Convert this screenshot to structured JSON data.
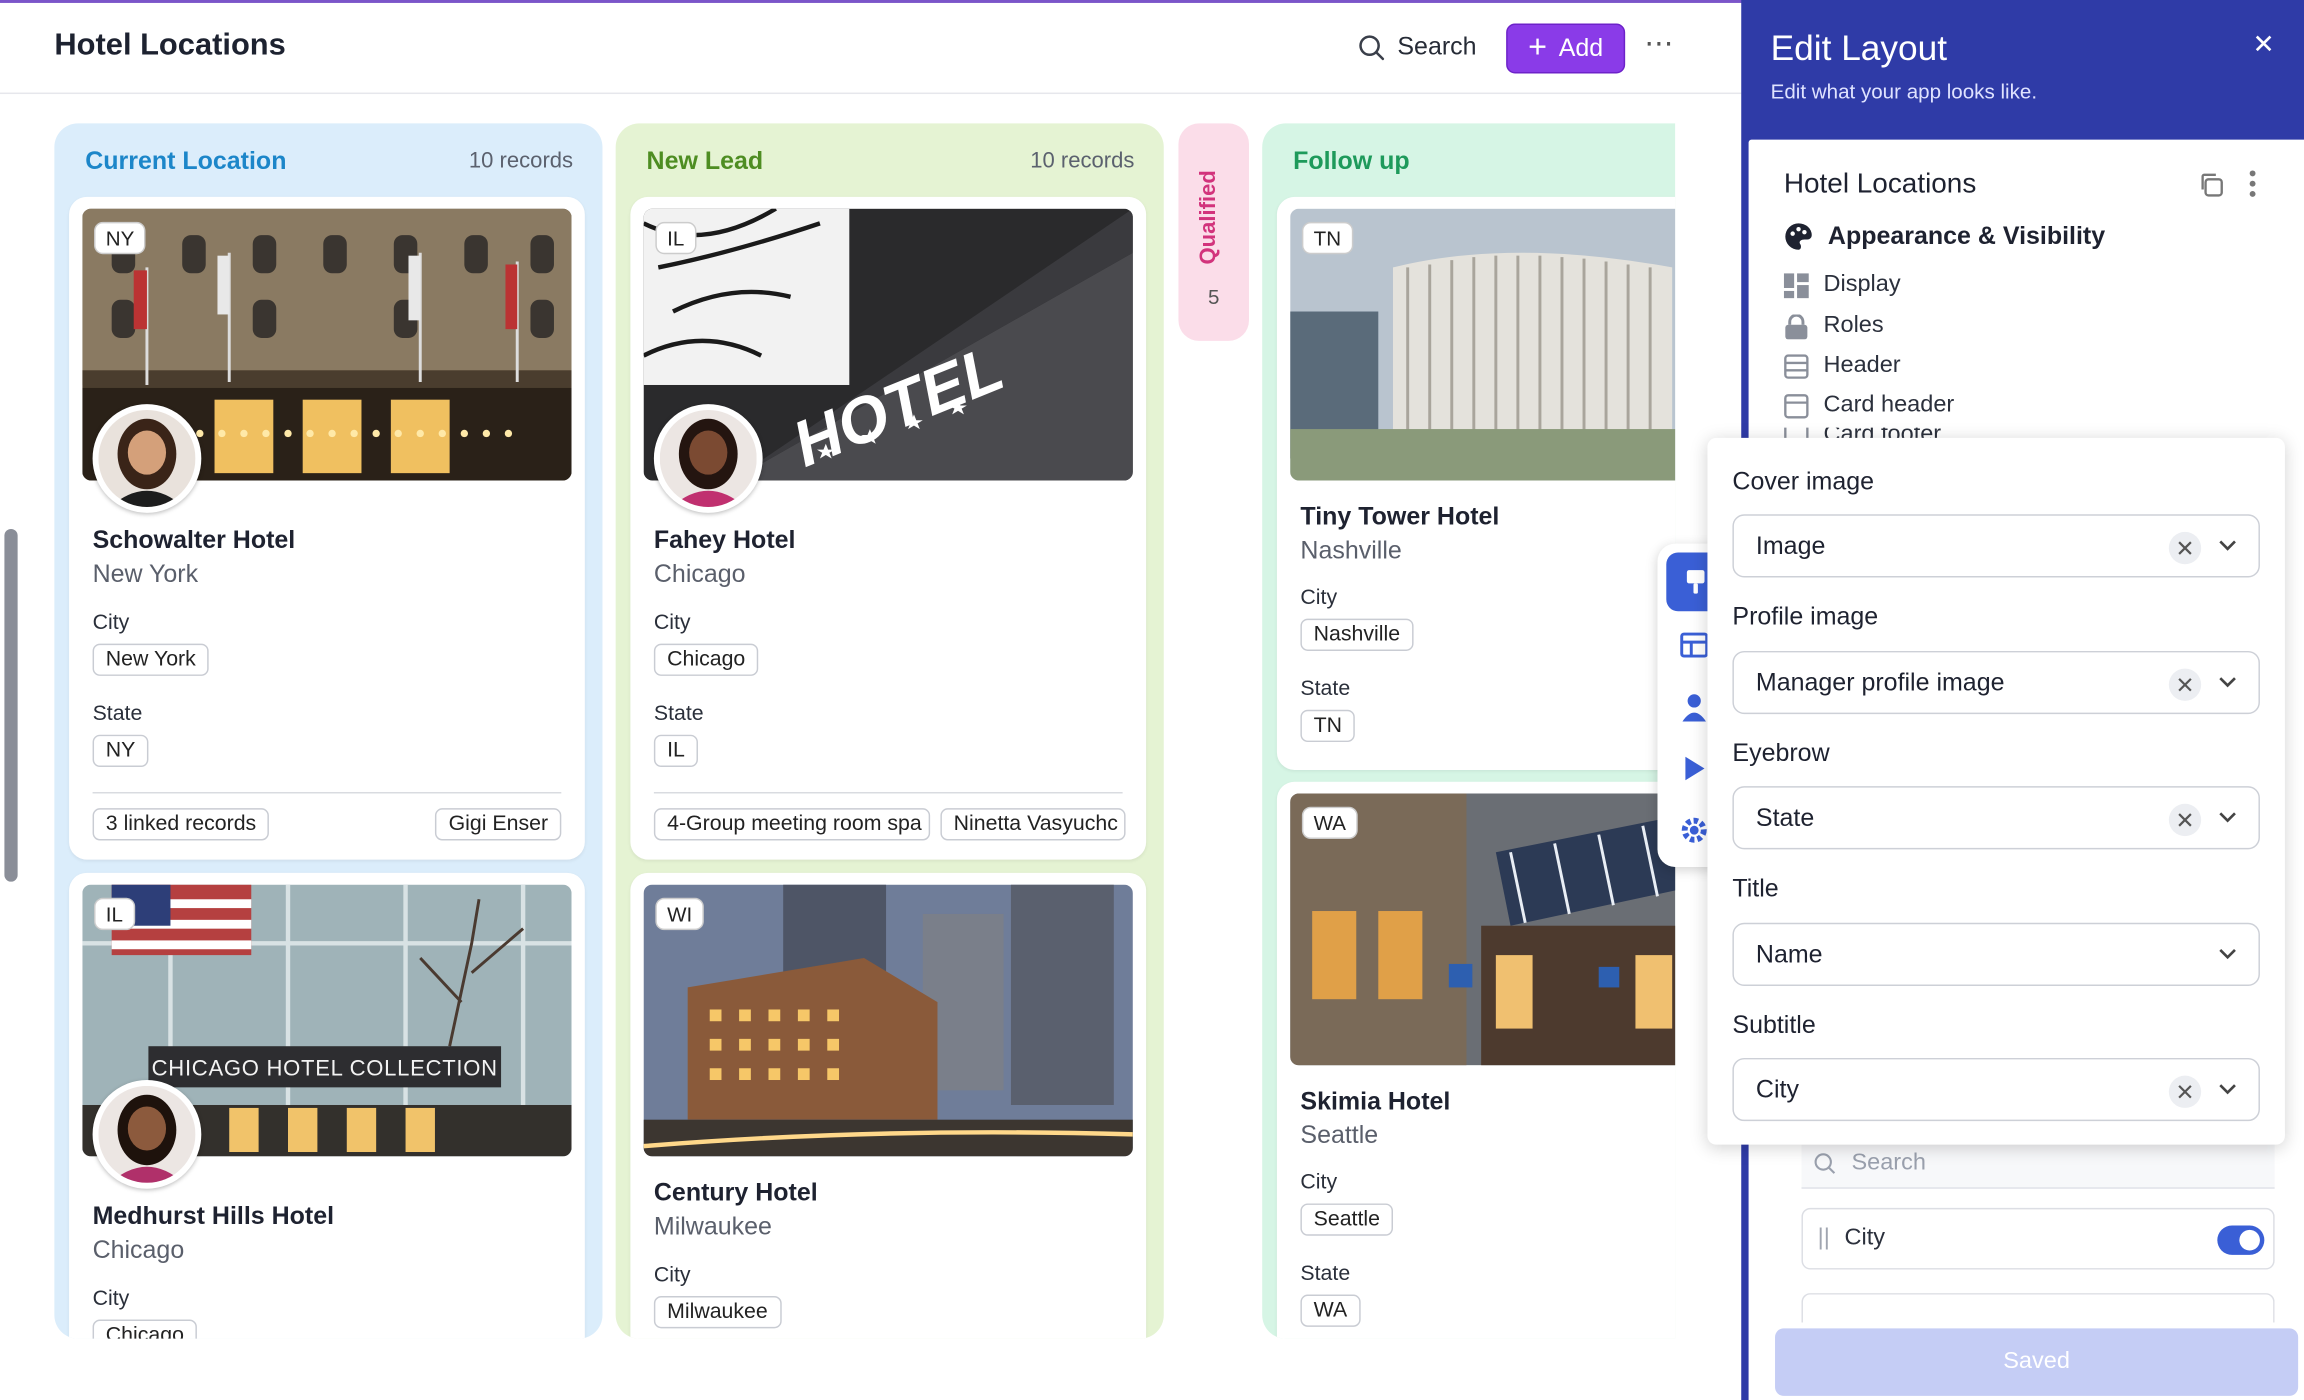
{
  "header": {
    "title": "Hotel Locations",
    "search_label": "Search",
    "add_label": "Add",
    "more_label": "⋯"
  },
  "columns": [
    {
      "title": "Current Location",
      "count": "10 records",
      "cards": [
        {
          "eyebrow": "NY",
          "title": "Schowalter Hotel",
          "subtitle": "New York",
          "city_label": "City",
          "city": "New York",
          "state_label": "State",
          "state": "NY",
          "footer_left": "3 linked records",
          "footer_right": "Gigi Enser"
        },
        {
          "eyebrow": "IL",
          "cover_text": "CHICAGO HOTEL COLLECTION",
          "title": "Medhurst Hills Hotel",
          "subtitle": "Chicago",
          "city_label": "City",
          "city": "Chicago"
        }
      ]
    },
    {
      "title": "New Lead",
      "count": "10 records",
      "cards": [
        {
          "eyebrow": "IL",
          "cover_text": "HOTEL",
          "title": "Fahey Hotel",
          "subtitle": "Chicago",
          "city_label": "City",
          "city": "Chicago",
          "state_label": "State",
          "state": "IL",
          "footer_left": "4-Group meeting room spa",
          "footer_right": "Ninetta Vasyuchc"
        },
        {
          "eyebrow": "WI",
          "title": "Century Hotel",
          "subtitle": "Milwaukee",
          "city_label": "City",
          "city": "Milwaukee"
        }
      ]
    },
    {
      "title": "Qualified",
      "count": "5"
    },
    {
      "title": "Follow up",
      "cards": [
        {
          "eyebrow": "TN",
          "title": "Tiny Tower Hotel",
          "subtitle": "Nashville",
          "city_label": "City",
          "city": "Nashville",
          "state_label": "State",
          "state": "TN"
        },
        {
          "eyebrow": "WA",
          "title": "Skimia Hotel",
          "subtitle": "Seattle",
          "city_label": "City",
          "city": "Seattle",
          "state_label": "State",
          "state": "WA"
        }
      ]
    }
  ],
  "panel": {
    "title": "Edit Layout",
    "subtitle": "Edit what your app looks like.",
    "close_label": "✕",
    "section_title": "Hotel Locations",
    "section_heading": "Appearance & Visibility",
    "items": [
      "Display",
      "Roles",
      "Header",
      "Card header",
      "Card footer"
    ],
    "search_placeholder": "Search",
    "row_label": "City",
    "saved_label": "Saved"
  },
  "popover": {
    "fields": [
      {
        "label": "Cover image",
        "value": "Image",
        "clearable": true
      },
      {
        "label": "Profile image",
        "value": "Manager profile image",
        "clearable": true
      },
      {
        "label": "Eyebrow",
        "value": "State",
        "clearable": true
      },
      {
        "label": "Title",
        "value": "Name",
        "clearable": false
      },
      {
        "label": "Subtitle",
        "value": "City",
        "clearable": true
      }
    ]
  },
  "toolbar": {
    "icons": [
      "brush-icon",
      "table-icon",
      "person-icon",
      "play-icon",
      "gear-icon"
    ]
  },
  "colors": {
    "accent_purple": "#8a3be8",
    "panel_blue": "#2f3ba7",
    "toggle_blue": "#3a5fd6",
    "col_current": "#dbedfb",
    "col_new_lead": "#e5f3d3",
    "col_qualified": "#fbdde9",
    "col_follow_up": "#d6f5e5"
  }
}
